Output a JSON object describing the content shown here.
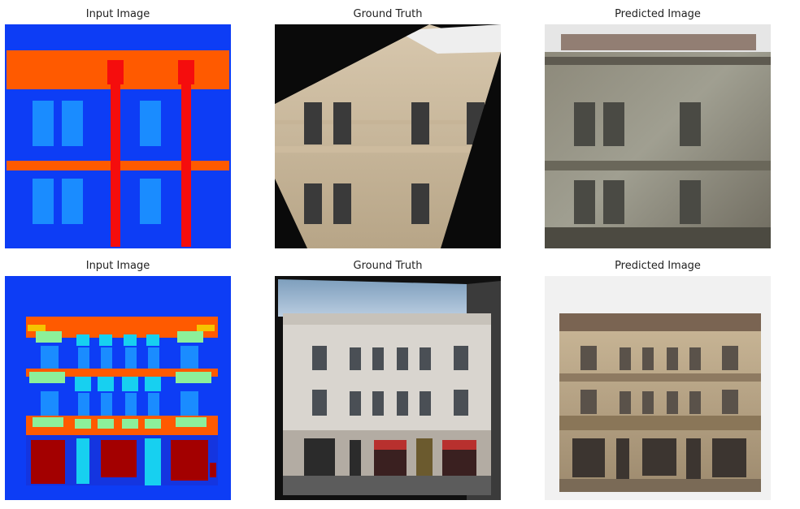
{
  "figure": {
    "rows": [
      {
        "panels": [
          {
            "title": "Input Image"
          },
          {
            "title": "Ground Truth"
          },
          {
            "title": "Predicted Image"
          }
        ]
      },
      {
        "panels": [
          {
            "title": "Input Image"
          },
          {
            "title": "Ground Truth"
          },
          {
            "title": "Predicted Image"
          }
        ]
      }
    ]
  },
  "colors": {
    "label_blue": "#0d3df5",
    "label_orange": "#ff5a00",
    "label_red": "#f50d0d",
    "label_window": "#1a8cff",
    "label_cyan": "#17d0f0",
    "label_green": "#8cf09a",
    "label_darkred": "#a30000"
  }
}
